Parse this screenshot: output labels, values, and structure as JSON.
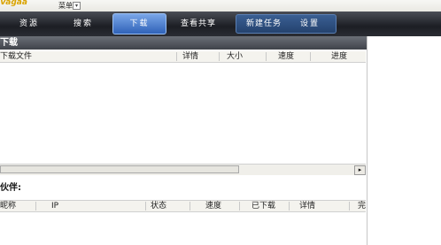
{
  "titlebar": {
    "logo_text": "Vagaa",
    "menu_label": "菜单",
    "menu_arrow": "▾"
  },
  "nav": {
    "tabs": [
      {
        "label": "资源"
      },
      {
        "label": "搜索"
      },
      {
        "label": "下载",
        "active": true
      },
      {
        "label": "查看共享"
      },
      {
        "label": "新建任务"
      },
      {
        "label": "设置"
      }
    ]
  },
  "download_section": {
    "title": "下载"
  },
  "download_list": {
    "columns": [
      "下载文件",
      "详情",
      "大小",
      "速度",
      "进度"
    ]
  },
  "scroll": {
    "right_arrow": "▸"
  },
  "peers_section": {
    "title": "伙伴:",
    "columns": [
      "昵称",
      "IP",
      "状态",
      "速度",
      "已下载",
      "详情",
      "完"
    ]
  }
}
